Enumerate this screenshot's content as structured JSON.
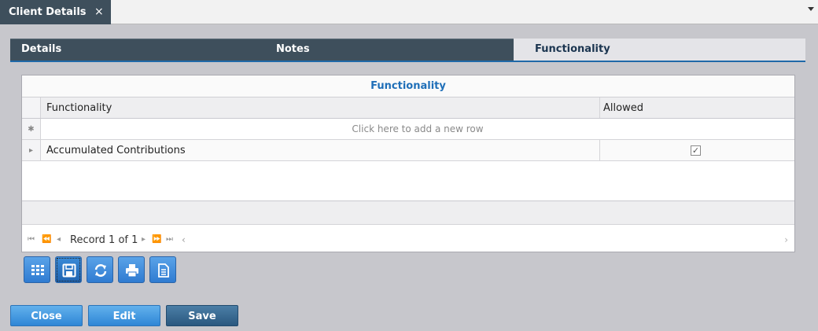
{
  "document_tab": {
    "title": "Client Details",
    "close_glyph": "×"
  },
  "section_tabs": [
    {
      "label": "Details"
    },
    {
      "label": "Notes"
    },
    {
      "label": "Functionality",
      "selected": true
    }
  ],
  "grid": {
    "title": "Functionality",
    "columns": [
      "Functionality",
      "Allowed"
    ],
    "add_row_hint": "Click here to add a new row",
    "rows": [
      {
        "functionality": "Accumulated Contributions",
        "allowed": true,
        "check_glyph": "✓"
      }
    ],
    "pager": {
      "record_label": "Record 1 of 1"
    }
  },
  "toolbar": {
    "icons": [
      "grid-view-icon",
      "save-icon",
      "refresh-icon",
      "print-icon",
      "document-icon"
    ]
  },
  "actions": {
    "close_label": "Close",
    "edit_label": "Edit",
    "save_label": "Save"
  },
  "colors": {
    "accent_blue": "#1f6fb8",
    "tab_bar": "#3e4f5c",
    "button_light": "#2f86d6",
    "button_dark": "#2a587f"
  }
}
